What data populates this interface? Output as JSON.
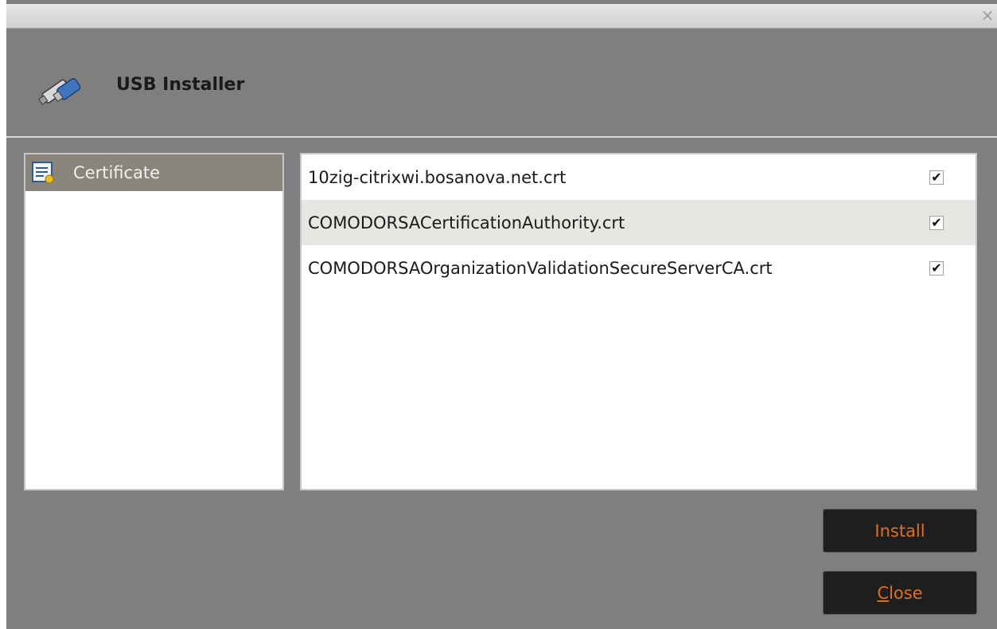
{
  "window": {
    "close_glyph": "×"
  },
  "header": {
    "title": "USB Installer",
    "icon": "usb-drive-icon"
  },
  "sidebar": {
    "items": [
      {
        "label": "Certificate",
        "icon": "certificate-icon",
        "selected": true
      }
    ]
  },
  "files": {
    "items": [
      {
        "name": "10zig-citrixwi.bosanova.net.crt",
        "checked": true,
        "check_glyph": "✔"
      },
      {
        "name": "COMODORSACertificationAuthority.crt",
        "checked": true,
        "check_glyph": "✔"
      },
      {
        "name": "COMODORSAOrganizationValidationSecureServerCA.crt",
        "checked": true,
        "check_glyph": "✔"
      }
    ]
  },
  "buttons": {
    "install_label": "Install",
    "close_label_first": "C",
    "close_label_rest": "lose"
  },
  "colors": {
    "window_bg": "#7f7f7f",
    "selected_item_bg": "#8a857a",
    "button_text": "#e07020",
    "button_bg": "#1e1e1e"
  }
}
